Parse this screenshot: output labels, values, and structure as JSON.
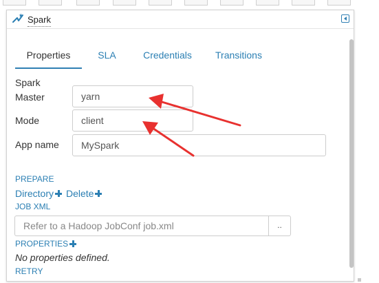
{
  "panel": {
    "title": "Spark",
    "logo_icon": "spark-logo-icon",
    "collapse_icon": "collapse-panel-icon"
  },
  "tabs": [
    {
      "label": "Properties",
      "active": true
    },
    {
      "label": "SLA",
      "active": false
    },
    {
      "label": "Credentials",
      "active": false
    },
    {
      "label": "Transitions",
      "active": false
    }
  ],
  "form": {
    "spark_label": "Spark",
    "master_label": "Master",
    "master_value": "yarn",
    "mode_label": "Mode",
    "mode_value": "client",
    "app_name_label": "App name",
    "app_name_value": "MySpark"
  },
  "prepare": {
    "section_label": "PREPARE",
    "directory_link": "Directory",
    "delete_link": "Delete"
  },
  "job_xml": {
    "section_label": "JOB XML",
    "placeholder": "Refer to a Hadoop JobConf job.xml",
    "browse_label": ".."
  },
  "properties": {
    "section_label": "PROPERTIES",
    "empty_text": "No properties defined."
  },
  "retry": {
    "section_label": "RETRY"
  },
  "colors": {
    "accent": "#2b7fb3",
    "annotation_arrow": "#e8312f"
  }
}
